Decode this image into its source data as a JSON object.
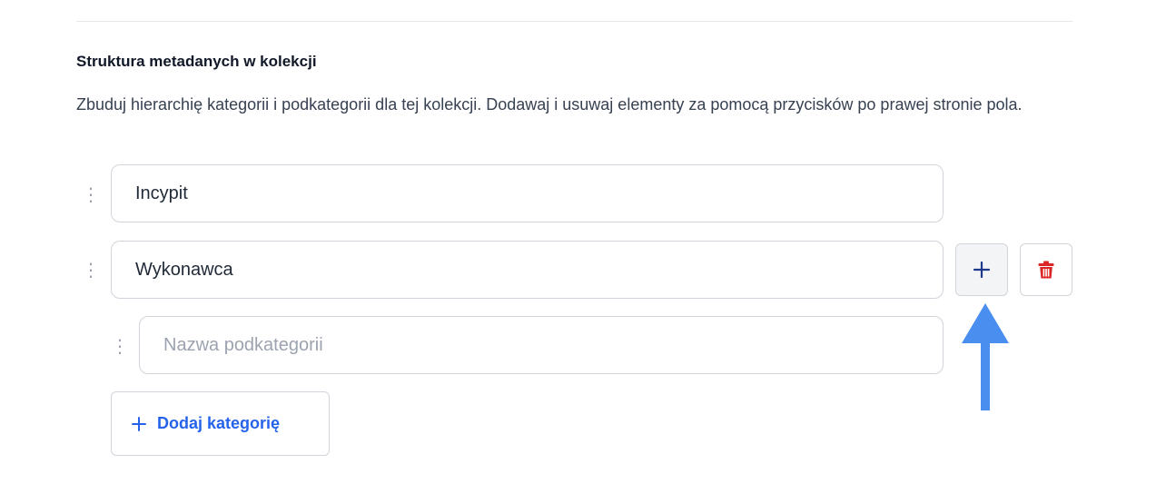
{
  "section": {
    "title": "Struktura metadanych w kolekcji",
    "description": "Zbuduj hierarchię kategorii i podkategorii dla tej kolekcji. Dodawaj i usuwaj elementy za pomocą przycisków po prawej stronie pola."
  },
  "categories": [
    {
      "value": "Incypit"
    },
    {
      "value": "Wykonawca"
    }
  ],
  "subcategory": {
    "placeholder": "Nazwa podkategorii",
    "value": ""
  },
  "buttons": {
    "add_category_label": "Dodaj kategorię",
    "add_subcategory_icon": "plus-icon",
    "delete_icon": "trash-icon"
  },
  "colors": {
    "accent": "#2563eb",
    "danger": "#dc2626",
    "annotation_arrow": "#4a8ef0"
  }
}
